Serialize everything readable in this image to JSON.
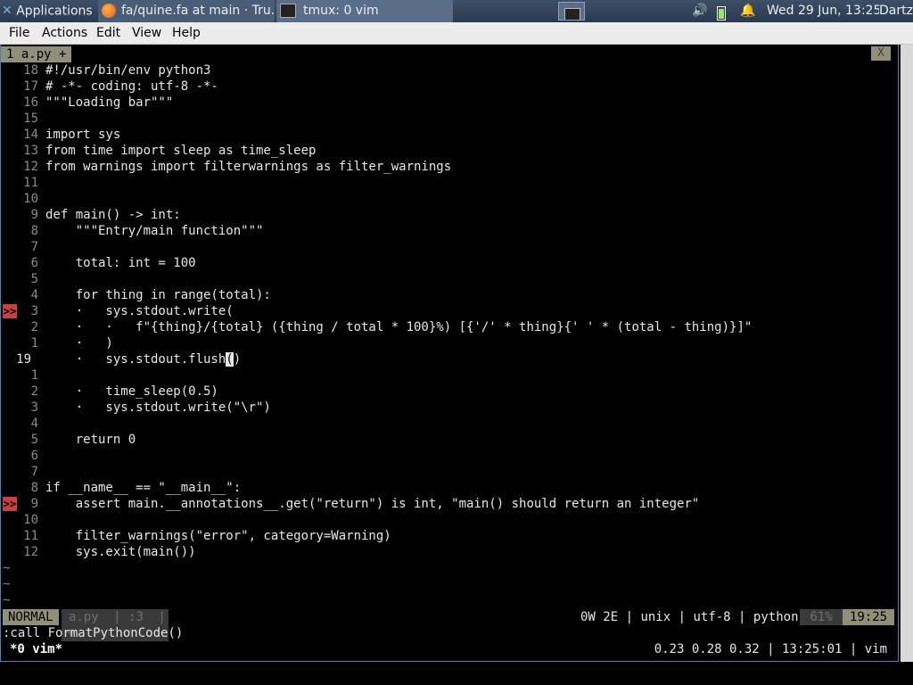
{
  "taskbar": {
    "applications": "Applications",
    "firefox_title": "fa/quine.fa at main · Tru...",
    "terminal_title": "tmux: 0 vim",
    "clock": "Wed 29 Jun, 13:25",
    "user": "Dartz",
    "icons": [
      "applications-icon",
      "firefox-icon",
      "terminal-icon",
      "volume-icon",
      "battery-icon",
      "notification-bell-icon"
    ]
  },
  "menubar": {
    "items": [
      "File",
      "Actions",
      "Edit",
      "View",
      "Help"
    ]
  },
  "tabline": {
    "tab": "1  a.py  +",
    "close": "X"
  },
  "editor": {
    "lines": [
      {
        "n": "18",
        "code": "#!/usr/bin/env python3"
      },
      {
        "n": "17",
        "code": "# -*- coding: utf-8 -*-"
      },
      {
        "n": "16",
        "code": "\"\"\"Loading bar\"\"\""
      },
      {
        "n": "15",
        "code": ""
      },
      {
        "n": "14",
        "code": "import sys"
      },
      {
        "n": "13",
        "code": "from time import sleep as time_sleep"
      },
      {
        "n": "12",
        "code": "from warnings import filterwarnings as filter_warnings"
      },
      {
        "n": "11",
        "code": ""
      },
      {
        "n": "10",
        "code": ""
      },
      {
        "n": "9",
        "code": "def main() -> int:"
      },
      {
        "n": "8",
        "code": "    \"\"\"Entry/main function\"\"\""
      },
      {
        "n": "7",
        "code": ""
      },
      {
        "n": "6",
        "code": "    total: int = 100"
      },
      {
        "n": "5",
        "code": ""
      },
      {
        "n": "4",
        "code": "    for thing in range(total):"
      },
      {
        "n": "3",
        "code": "    ·   sys.stdout.write(",
        "sign": ">>"
      },
      {
        "n": "2",
        "code": "    ·   ·   f\"{thing}/{total} ({thing / total * 100}%) [{'/' * thing}{' ' * (total - thing)}]\""
      },
      {
        "n": "1",
        "code": "    ·   )"
      },
      {
        "n": "19",
        "code": "    ·   sys.stdout.flush()",
        "current": true
      },
      {
        "n": "1",
        "code": ""
      },
      {
        "n": "2",
        "code": "    ·   time_sleep(0.5)"
      },
      {
        "n": "3",
        "code": "    ·   sys.stdout.write(\"\\r\")"
      },
      {
        "n": "4",
        "code": ""
      },
      {
        "n": "5",
        "code": "    return 0"
      },
      {
        "n": "6",
        "code": ""
      },
      {
        "n": "7",
        "code": ""
      },
      {
        "n": "8",
        "code": "if __name__ == \"__main__\":"
      },
      {
        "n": "9",
        "code": "    assert main.__annotations__.get(\"return\") is int, \"main() should return an integer\"",
        "sign": ">>"
      },
      {
        "n": "10",
        "code": ""
      },
      {
        "n": "11",
        "code": "    filter_warnings(\"error\", category=Warning)"
      },
      {
        "n": "12",
        "code": "    sys.exit(main())"
      }
    ],
    "tildes": [
      "~",
      "~",
      "~"
    ]
  },
  "statusline": {
    "mode": "NORMAL",
    "file": "a.py",
    "col": ":3",
    "plus": "+",
    "warnings": "0W 2E",
    "fileformat": "unix",
    "encoding": "utf-8",
    "filetype": "python",
    "percent": "61%",
    "position": "19:25"
  },
  "cmdline": ":call FormatPythonCode()",
  "tmux": {
    "window": "*0 vim*",
    "load": "0.23 0.28 0.32 | 13:25:01 | vim"
  },
  "colors": {
    "sign": "#c84040",
    "mode_bg": "#8f8f7a",
    "taskbar": "#2f4057"
  }
}
